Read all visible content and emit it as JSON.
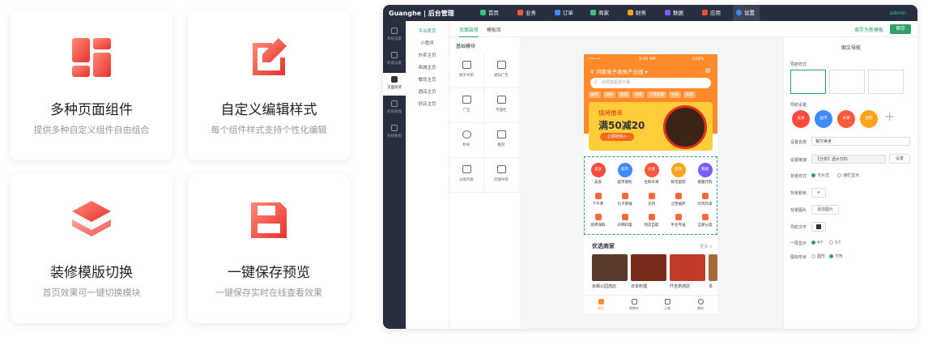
{
  "features": [
    {
      "title": "多种页面组件",
      "desc": "提供多种自定义组件自由组合"
    },
    {
      "title": "自定义编辑样式",
      "desc": "每个组件样式支持个性化编辑"
    },
    {
      "title": "装修模版切换",
      "desc": "首页效果可一键切换模块"
    },
    {
      "title": "一键保存预览",
      "desc": "一键保存实时在线查看效果"
    }
  ],
  "app": {
    "logo": "Guanghe | 后台管理",
    "nav": [
      "首页",
      "业务",
      "订单",
      "商家",
      "财务",
      "数据",
      "应用",
      "设置"
    ],
    "user": "admin",
    "sidebar": [
      "系统设置",
      "商家设置",
      "页面装修",
      "权限管理",
      "系统数据"
    ],
    "subnav": [
      "平台首页",
      "小程序",
      "外卖主页",
      "商城主页",
      "餐饮主页",
      "酒店主页",
      "好店主页"
    ],
    "tabs": [
      "页面装修",
      "模板库"
    ],
    "save_preview": "保存为新模板",
    "save": "保存",
    "comp_title": "基础模块",
    "components": [
      "图文导航",
      "通知广告",
      "广告",
      "专题栏",
      "秒杀",
      "推荐",
      "分类列表",
      "店铺导航"
    ],
    "phone": {
      "status_time": "9:00 AM",
      "battery": "100%",
      "location": "河南电子商务产业园",
      "search_placeholder": "必胜客超值午餐",
      "tags": [
        "披萨",
        "酒水",
        "旅游",
        "汉堡",
        "汉堡套餐",
        "生鲜",
        "奶茶"
      ],
      "banner_title": "烧烤撸串",
      "banner_offer": "满50减20",
      "banner_btn": "立即抢购>",
      "icons": [
        {
          "badge": "美食",
          "label": "美食",
          "color": "#ff4a3d"
        },
        {
          "badge": "超市",
          "label": "超市便利",
          "color": "#3d8bff"
        },
        {
          "badge": "水果",
          "label": "生鲜水果",
          "color": "#ff5a3d"
        },
        {
          "badge": "蛋糕",
          "label": "鲜花蛋糕",
          "color": "#ffa41b"
        },
        {
          "badge": "跑腿",
          "label": "跑腿代购",
          "color": "#7b5cff"
        }
      ],
      "small": [
        "下午茶",
        "包子粥铺",
        "买药",
        "汉堡披萨",
        "炸鸡炸串",
        "烧烤海鲜",
        "日韩料理",
        "到店自取",
        "平台专送",
        "全部分类"
      ],
      "merchants_title": "优选商家",
      "more": "更多 >",
      "merchants": [
        "永辉公园茂店",
        "日本料理",
        "仟吉烘焙店",
        "多"
      ],
      "tabbar": [
        "首页",
        "购物车",
        "订单",
        "我的"
      ]
    },
    "props": {
      "title": "图文导航",
      "nav_style": "导航样式",
      "nav_set": "导航设置",
      "nav_badges": [
        {
          "t": "美食",
          "c": "#ff4a3d"
        },
        {
          "t": "超市",
          "c": "#3d8bff"
        },
        {
          "t": "水果",
          "c": "#ff5a3d"
        },
        {
          "t": "蛋糕",
          "c": "#ffa41b"
        }
      ],
      "name_label": "设置名称",
      "name_value": "餐饮美食",
      "link_label": "设置链接",
      "link_value": "【分类】酒水饮料",
      "set_btn": "设置",
      "bg_style": "背景样式",
      "opt_card": "卡片式",
      "opt_full": "通栏显示",
      "bg_color": "背景颜色",
      "bg_image": "背景图片",
      "add_image": "添加图片",
      "text_label": "导航文字",
      "per_row": "一屏显示",
      "opt4": "4个",
      "opt5": "5个",
      "shape": "图标形状",
      "opt_round": "圆形",
      "opt_square": "方形"
    }
  }
}
